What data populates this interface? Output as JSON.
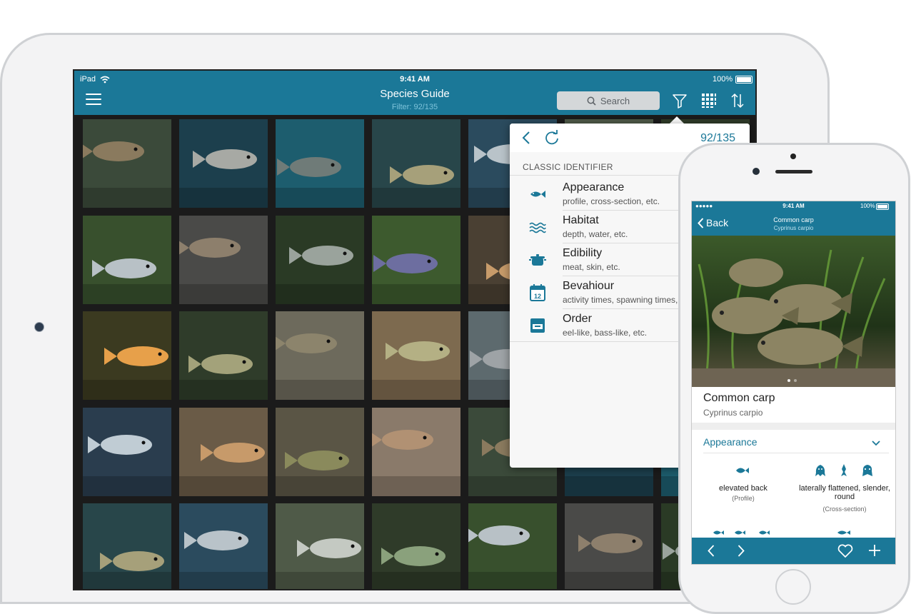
{
  "ipad": {
    "status": {
      "device": "iPad",
      "time": "9:41 AM",
      "battery": "100%"
    },
    "nav": {
      "title": "Species Guide",
      "subtitle": "Filter: 92/135",
      "search_placeholder": "Search"
    },
    "popover": {
      "count": "92/135",
      "section_title": "CLASSIC IDENTIFIER",
      "items": [
        {
          "label": "Appearance",
          "sub": "profile, cross-section, etc.",
          "icon": "fish-icon"
        },
        {
          "label": "Habitat",
          "sub": "depth, water, etc.",
          "icon": "waves-icon"
        },
        {
          "label": "Edibility",
          "sub": "meat, skin, etc.",
          "icon": "pot-icon"
        },
        {
          "label": "Bevahiour",
          "sub": "activity times, spawning times, etc.",
          "icon": "calendar-icon",
          "icon_text": "12"
        },
        {
          "label": "Order",
          "sub": "eel-like, bass-like, etc.",
          "icon": "tray-icon"
        }
      ]
    }
  },
  "iphone": {
    "status": {
      "carrier": "●●●●● ",
      "time": "9:41 AM",
      "battery": "100%"
    },
    "nav": {
      "back_label": "Back",
      "title": "Common carp",
      "subtitle": "Cyprinus carpio"
    },
    "species": {
      "name": "Common carp",
      "latin": "Cyprinus carpio"
    },
    "section": {
      "title": "Appearance"
    },
    "features": [
      {
        "label": "elevated back",
        "sub": "(Profile)"
      },
      {
        "label": "laterally flattened, slender, round",
        "sub": "(Cross-section)"
      }
    ]
  },
  "colors": {
    "accent": "#1b7898",
    "accent_light": "#7ec3da",
    "popover_bg": "#f7f7f7"
  }
}
